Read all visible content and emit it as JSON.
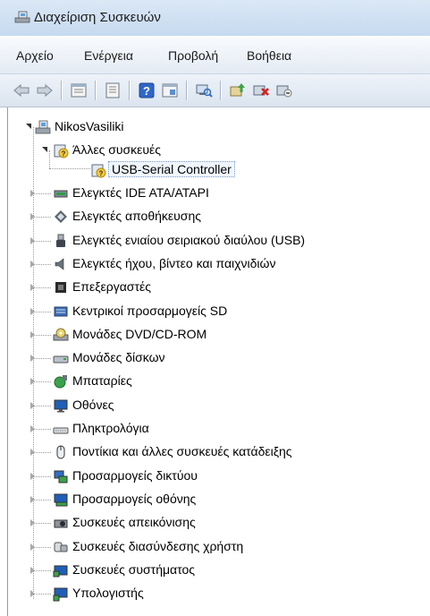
{
  "window": {
    "title": "Διαχείριση Συσκευών",
    "app_icon": "device-manager-icon"
  },
  "menu": {
    "items": [
      "Αρχείο",
      "Ενέργεια",
      "Προβολή",
      "Βοήθεια"
    ]
  },
  "toolbar": {
    "buttons": [
      "back-arrow-icon",
      "forward-arrow-icon",
      "properties-icon",
      "list-view-icon",
      "help-icon",
      "action-icon",
      "scan-hardware-icon",
      "update-driver-icon",
      "uninstall-icon",
      "disable-icon"
    ]
  },
  "tree": {
    "root": "NikosVasiliki",
    "other_devices": "Άλλες συσκευές",
    "usb_serial": "USB-Serial Controller",
    "categories": [
      "Ελεγκτές IDE ATA/ATAPI",
      "Ελεγκτές αποθήκευσης",
      "Ελεγκτές ενιαίου σειριακού διαύλου (USB)",
      "Ελεγκτές ήχου, βίντεο και παιχνιδιών",
      "Επεξεργαστές",
      "Κεντρικοί προσαρμογείς SD",
      "Μονάδες DVD/CD-ROM",
      "Μονάδες δίσκων",
      "Μπαταρίες",
      "Οθόνες",
      "Πληκτρολόγια",
      "Ποντίκια και άλλες συσκευές κατάδειξης",
      "Προσαρμογείς δικτύου",
      "Προσαρμογείς οθόνης",
      "Συσκευές απεικόνισης",
      "Συσκευές διασύνδεσης χρήστη",
      "Συσκευές συστήματος",
      "Υπολογιστής"
    ],
    "category_icons": [
      "ide-controller-icon",
      "storage-controller-icon",
      "usb-plug-icon",
      "speaker-icon",
      "processor-icon",
      "sd-host-icon",
      "dvd-drive-icon",
      "disk-drive-icon",
      "battery-icon",
      "monitor-icon",
      "keyboard-icon",
      "mouse-icon",
      "network-adapter-icon",
      "display-adapter-icon",
      "imaging-device-icon",
      "hid-device-icon",
      "system-device-icon",
      "computer-icon"
    ]
  }
}
